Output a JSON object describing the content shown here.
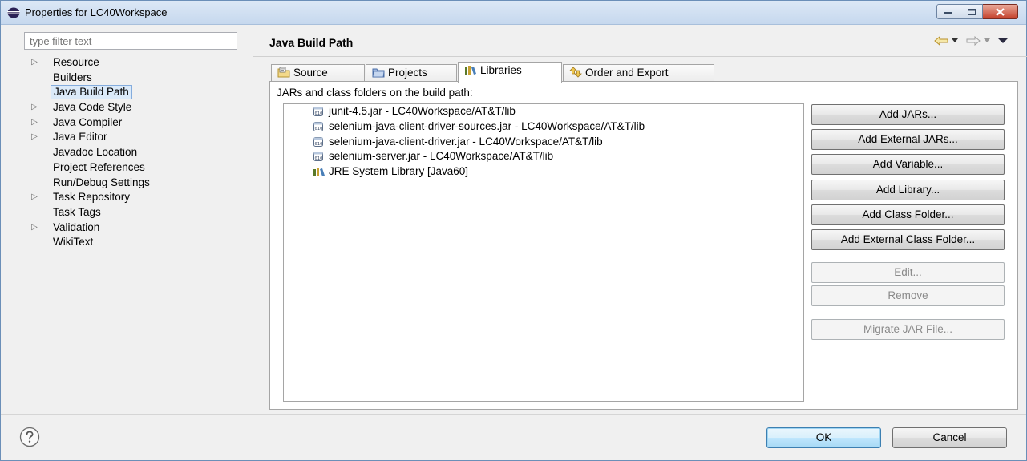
{
  "window": {
    "title": "Properties for LC40Workspace"
  },
  "filter": {
    "placeholder": "type filter text"
  },
  "tree": {
    "items": [
      {
        "label": "Resource",
        "expandable": true,
        "selected": false
      },
      {
        "label": "Builders",
        "expandable": false,
        "selected": false
      },
      {
        "label": "Java Build Path",
        "expandable": false,
        "selected": true
      },
      {
        "label": "Java Code Style",
        "expandable": true,
        "selected": false
      },
      {
        "label": "Java Compiler",
        "expandable": true,
        "selected": false
      },
      {
        "label": "Java Editor",
        "expandable": true,
        "selected": false
      },
      {
        "label": "Javadoc Location",
        "expandable": false,
        "selected": false
      },
      {
        "label": "Project References",
        "expandable": false,
        "selected": false
      },
      {
        "label": "Run/Debug Settings",
        "expandable": false,
        "selected": false
      },
      {
        "label": "Task Repository",
        "expandable": true,
        "selected": false
      },
      {
        "label": "Task Tags",
        "expandable": false,
        "selected": false
      },
      {
        "label": "Validation",
        "expandable": true,
        "selected": false
      },
      {
        "label": "WikiText",
        "expandable": false,
        "selected": false
      }
    ]
  },
  "page": {
    "title": "Java Build Path"
  },
  "tabs": [
    {
      "label": "Source",
      "icon": "source-folder-icon",
      "active": false
    },
    {
      "label": "Projects",
      "icon": "projects-icon",
      "active": false
    },
    {
      "label": "Libraries",
      "icon": "libraries-icon",
      "active": true
    },
    {
      "label": "Order and Export",
      "icon": "order-export-icon",
      "active": false
    }
  ],
  "libraries": {
    "heading": "JARs and class folders on the build path:",
    "entries": [
      {
        "label": "junit-4.5.jar - LC40Workspace/AT&T/lib",
        "icon": "jar-icon"
      },
      {
        "label": "selenium-java-client-driver-sources.jar - LC40Workspace/AT&T/lib",
        "icon": "jar-icon"
      },
      {
        "label": "selenium-java-client-driver.jar - LC40Workspace/AT&T/lib",
        "icon": "jar-icon"
      },
      {
        "label": "selenium-server.jar - LC40Workspace/AT&T/lib",
        "icon": "jar-icon"
      },
      {
        "label": "JRE System Library [Java60]",
        "icon": "library-icon"
      }
    ],
    "buttons": [
      {
        "label": "Add JARs...",
        "enabled": true
      },
      {
        "label": "Add External JARs...",
        "enabled": true
      },
      {
        "label": "Add Variable...",
        "enabled": true
      },
      {
        "label": "Add Library...",
        "enabled": true
      },
      {
        "label": "Add Class Folder...",
        "enabled": true
      },
      {
        "label": "Add External Class Folder...",
        "enabled": true
      },
      {
        "label": "Edit...",
        "enabled": false
      },
      {
        "label": "Remove",
        "enabled": false
      },
      {
        "label": "Migrate JAR File...",
        "enabled": false
      }
    ]
  },
  "footer": {
    "ok_label": "OK",
    "cancel_label": "Cancel"
  },
  "colors": {
    "selection_bg": "#dbeaf9",
    "selection_border": "#84acdd",
    "close_button": "#c5412b",
    "default_button_border": "#3c7fb1"
  }
}
